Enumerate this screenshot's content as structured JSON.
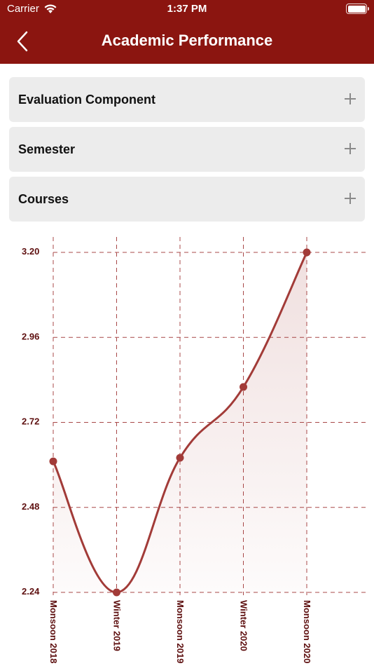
{
  "status_bar": {
    "carrier": "Carrier",
    "time": "1:37 PM",
    "wifi_icon": "wifi-icon",
    "battery_icon": "battery-icon"
  },
  "nav": {
    "title": "Academic Performance",
    "back_icon": "chevron-left-icon"
  },
  "accordions": [
    {
      "label": "Evaluation Component",
      "icon": "plus-icon"
    },
    {
      "label": "Semester",
      "icon": "plus-icon"
    },
    {
      "label": "Courses",
      "icon": "plus-icon"
    }
  ],
  "colors": {
    "brand": "#8b1510",
    "line": "#a23b38",
    "point": "#a23b38",
    "grid": "#a84848",
    "tick_text": "#5e1010",
    "panel": "#ececec"
  },
  "chart_data": {
    "type": "line",
    "smooth": true,
    "area_fill": true,
    "categories": [
      "Monsoon 2018",
      "Winter 2019",
      "Monsoon 2019",
      "Winter 2020",
      "Monsoon 2020"
    ],
    "values": [
      2.61,
      2.24,
      2.62,
      2.82,
      3.2
    ],
    "yticks": [
      "3.20",
      "2.96",
      "2.72",
      "2.48",
      "2.24"
    ],
    "ylim": [
      2.24,
      3.2
    ],
    "grid": true,
    "grid_style": "dashed"
  }
}
